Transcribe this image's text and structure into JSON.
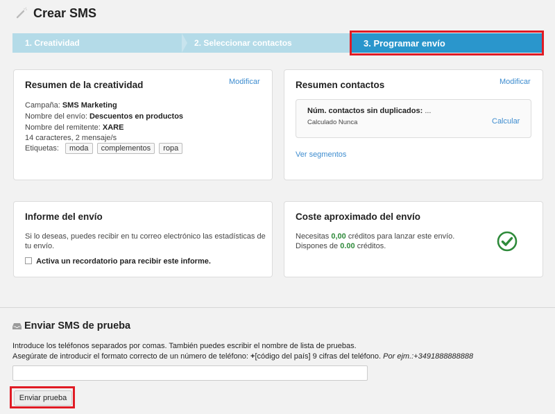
{
  "page": {
    "title": "Crear SMS"
  },
  "steps": [
    {
      "label": "1. Creatividad"
    },
    {
      "label": "2. Seleccionar contactos"
    },
    {
      "label": "3. Programar envío"
    }
  ],
  "summary_creative": {
    "title": "Resumen de la creatividad",
    "modify": "Modificar",
    "campaign_label": "Campaña:",
    "campaign_value": "SMS Marketing",
    "name_label": "Nombre del envío:",
    "name_value": "Descuentos en productos",
    "sender_label": "Nombre del remitente:",
    "sender_value": "XARE",
    "chars": "14 caracteres, 2 mensaje/s",
    "tags_label": "Etiquetas:",
    "tags": [
      "moda",
      "complementos",
      "ropa"
    ]
  },
  "summary_contacts": {
    "title": "Resumen contactos",
    "modify": "Modificar",
    "count_label": "Núm. contactos sin duplicados:",
    "count_value": "...",
    "calc_status": "Calculado Nunca",
    "calc_link": "Calcular",
    "segments_link": "Ver segmentos"
  },
  "report": {
    "title": "Informe del envío",
    "text1": "Si lo deseas, puedes recibir en tu correo electrónico las estadísticas de",
    "text2": "tu envío.",
    "checkbox_label": "Activa un recordatorio para recibir este informe."
  },
  "cost": {
    "title": "Coste aproximado del envío",
    "need_prefix": "Necesitas",
    "need_value": "0,00",
    "need_suffix": "créditos para lanzar este envío.",
    "have_prefix": "Dispones de",
    "have_value": "0.00",
    "have_suffix": "créditos."
  },
  "test_sms": {
    "title": "Enviar SMS de prueba",
    "desc1": "Introduce los teléfonos separados por comas. También puedes escribir el nombre de lista de pruebas.",
    "desc2_a": "Asegúrate de introducir el formato correcto de un número de teléfono:",
    "desc2_plus": "+",
    "desc2_b": "[código del país] 9 cifras del teléfono.",
    "desc2_example": "Por ejm.:+3491888888888",
    "input_value": "",
    "input_placeholder": "",
    "button": "Enviar prueba"
  },
  "colors": {
    "accent": "#2a96cc",
    "step_inactive": "#b4dbe8",
    "highlight": "#e01b24",
    "link": "#3d8ccf",
    "success": "#2e8a3a"
  }
}
